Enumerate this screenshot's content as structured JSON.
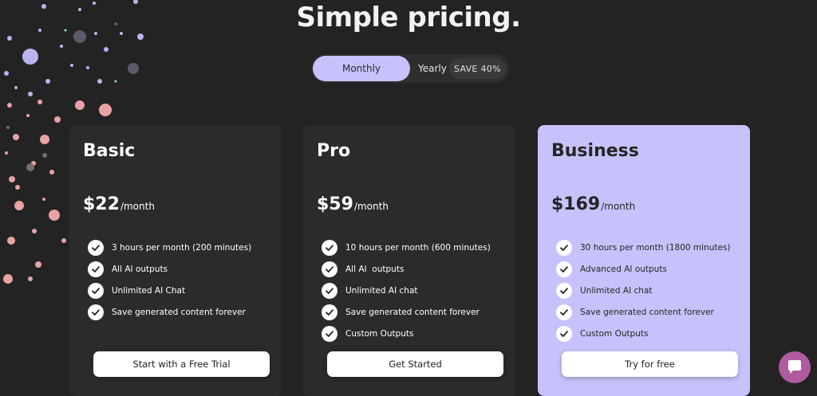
{
  "header": {
    "title": "Simple pricing."
  },
  "billing_toggle": {
    "monthly_label": "Monthly",
    "yearly_label": "Yearly",
    "save_badge": "SAVE 40%",
    "selected": "Monthly"
  },
  "plans": [
    {
      "name": "Basic",
      "price": "$22",
      "period": "/month",
      "features": [
        "3 hours per month (200 minutes)",
        "All AI outputs",
        "Unlimited AI Chat",
        "Save generated content forever"
      ],
      "cta": "Start with a Free Trial"
    },
    {
      "name": "Pro",
      "price": "$59",
      "period": "/month",
      "features": [
        "10 hours per month (600 minutes)",
        "All AI  outputs",
        "Unlimited AI chat",
        "Save generated content forever",
        "Custom Outputs"
      ],
      "cta": "Get Started"
    },
    {
      "name": "Business",
      "price": "$169",
      "period": "/month",
      "features": [
        "30 hours per month (1800 minutes)",
        "Advanced AI outputs",
        "Unlimited AI chat",
        "Save generated content forever",
        "Custom Outputs"
      ],
      "cta": "Try for free"
    }
  ],
  "colors": {
    "background": "#232323",
    "card": "#2b2b2b",
    "accent": "#c7c2fb",
    "chat_button": "#b05aa0"
  },
  "icons": {
    "feature": "check-icon",
    "chat": "chat-bubble-icon"
  }
}
